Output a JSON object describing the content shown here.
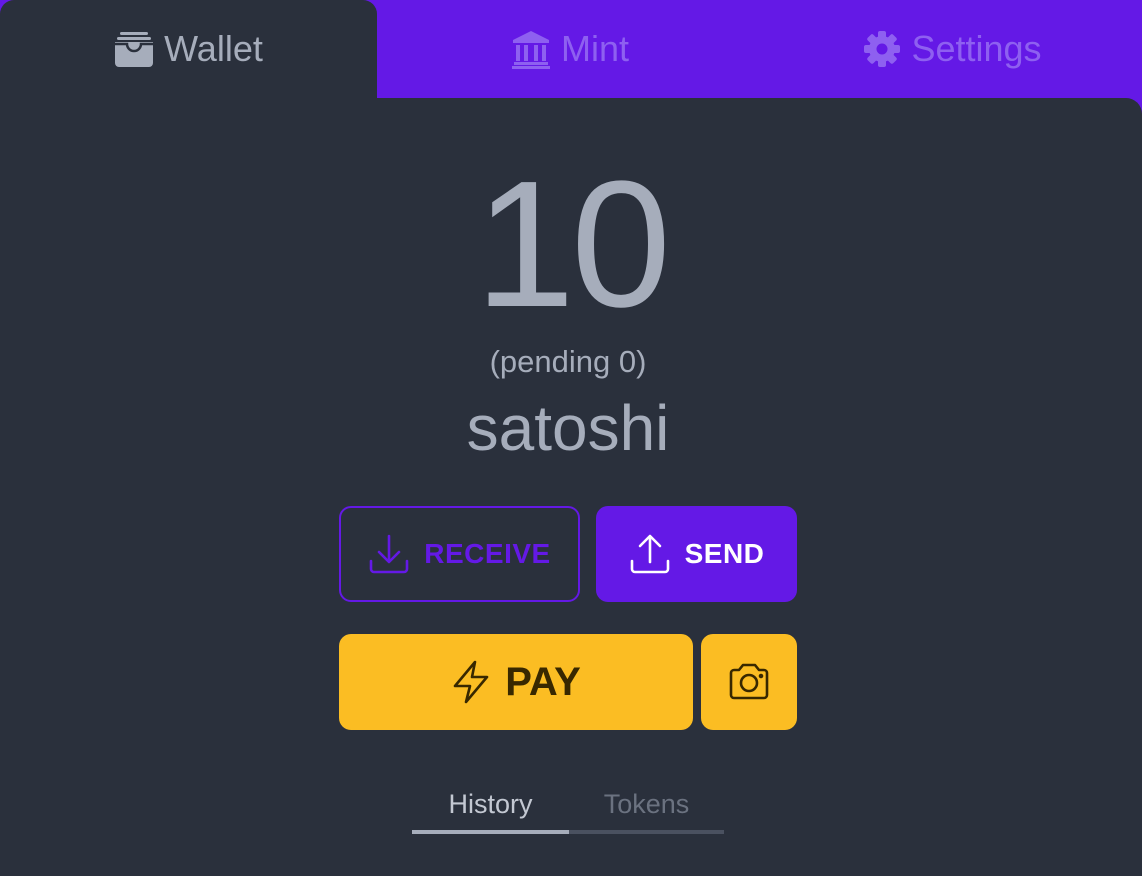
{
  "tabs": [
    {
      "label": "Wallet",
      "icon": "wallet-icon",
      "active": true
    },
    {
      "label": "Mint",
      "icon": "bank-icon",
      "active": false
    },
    {
      "label": "Settings",
      "icon": "gear-icon",
      "active": false
    }
  ],
  "wallet": {
    "balance": "10",
    "pending": "(pending 0)",
    "unit": "satoshi"
  },
  "actions": {
    "receive_label": "RECEIVE",
    "receive_icon": "download-icon",
    "send_label": "SEND",
    "send_icon": "upload-icon",
    "pay_label": "PAY",
    "pay_icon": "lightning-icon",
    "camera_icon": "camera-icon"
  },
  "subtabs": [
    {
      "label": "History",
      "active": true
    },
    {
      "label": "Tokens",
      "active": false
    }
  ],
  "colors": {
    "primary": "#6419e6",
    "panel": "#2a303c",
    "text": "#a6adbb",
    "warning": "#fbbd23",
    "warning_text": "#382800"
  }
}
